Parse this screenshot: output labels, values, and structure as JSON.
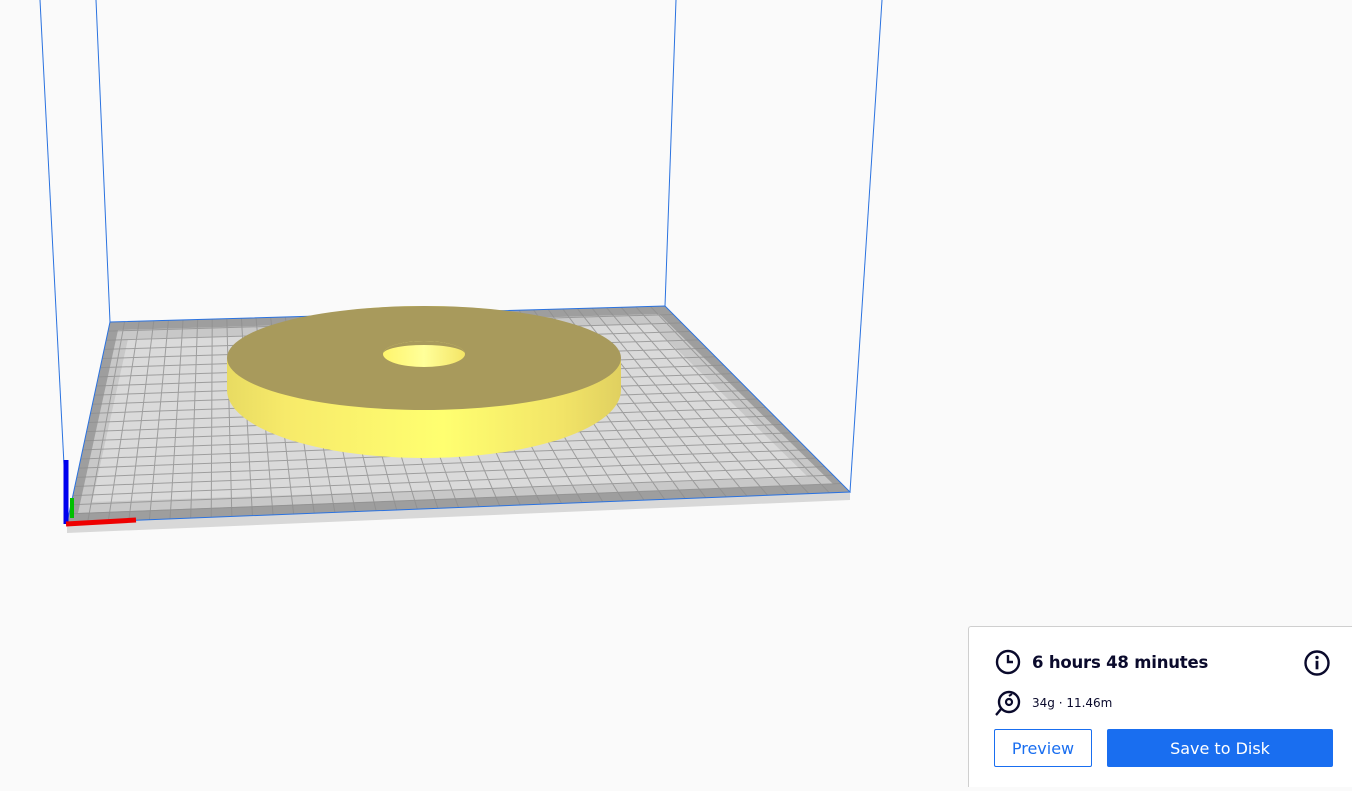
{
  "scene": {
    "background_color": "#fafafa",
    "build_volume_line_color": "#1f6fe0",
    "build_plate_color": "#b4b4b4",
    "model_color": "#f9f371",
    "axis_colors": {
      "x": "#ff0000",
      "y": "#00c000",
      "z": "#0000ff"
    }
  },
  "print_info": {
    "time": "6 hours 48 minutes",
    "material": "34g · 11.46m",
    "icons": {
      "time": "clock-icon",
      "material": "spool-icon",
      "details": "info-icon"
    }
  },
  "actions": {
    "preview_label": "Preview",
    "save_label": "Save to Disk",
    "accent_color": "#196ef0"
  }
}
